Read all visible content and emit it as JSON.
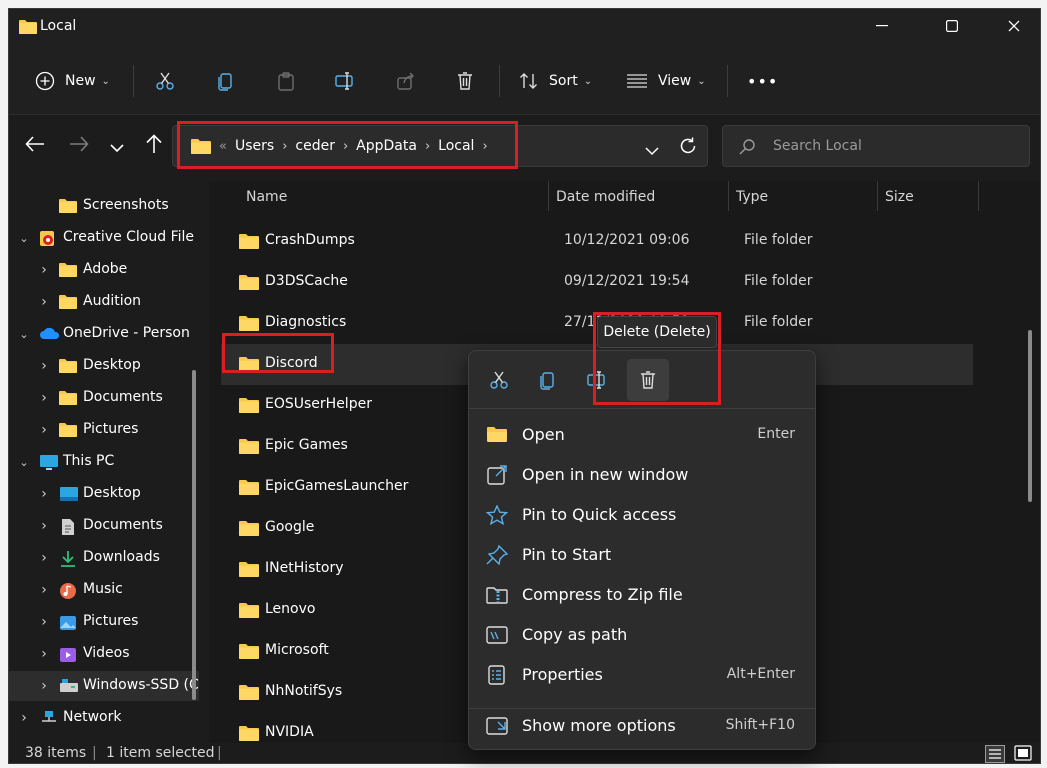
{
  "window": {
    "title": "Local"
  },
  "toolbar": {
    "new_label": "New",
    "sort_label": "Sort",
    "view_label": "View",
    "more_label": "•••"
  },
  "address": {
    "overflow": "«",
    "crumbs": [
      "Users",
      "ceder",
      "AppData",
      "Local"
    ]
  },
  "search": {
    "placeholder": "Search Local"
  },
  "sidebar": {
    "items": [
      {
        "label": "Screenshots",
        "icon": "folder-icon",
        "expandable": false
      },
      {
        "label": "Creative Cloud File",
        "icon": "creative-cloud-icon",
        "expandable": true,
        "expanded": true
      },
      {
        "label": "Adobe",
        "icon": "folder-icon",
        "expandable": true
      },
      {
        "label": "Audition",
        "icon": "folder-icon",
        "expandable": true
      },
      {
        "label": "OneDrive - Person",
        "icon": "onedrive-icon",
        "expandable": true,
        "expanded": true
      },
      {
        "label": "Desktop",
        "icon": "folder-icon",
        "expandable": true
      },
      {
        "label": "Documents",
        "icon": "folder-icon",
        "expandable": true
      },
      {
        "label": "Pictures",
        "icon": "folder-icon",
        "expandable": true
      },
      {
        "label": "This PC",
        "icon": "pc-icon",
        "expandable": true,
        "expanded": true
      },
      {
        "label": "Desktop",
        "icon": "desktop-icon",
        "expandable": true
      },
      {
        "label": "Documents",
        "icon": "documents-icon",
        "expandable": true
      },
      {
        "label": "Downloads",
        "icon": "downloads-icon",
        "expandable": true
      },
      {
        "label": "Music",
        "icon": "music-icon",
        "expandable": true
      },
      {
        "label": "Pictures",
        "icon": "pictures-icon",
        "expandable": true
      },
      {
        "label": "Videos",
        "icon": "videos-icon",
        "expandable": true
      },
      {
        "label": "Windows-SSD (C",
        "icon": "drive-icon",
        "expandable": true,
        "selected": true
      },
      {
        "label": "Network",
        "icon": "network-icon",
        "expandable": true
      }
    ]
  },
  "columns": {
    "name": "Name",
    "date": "Date modified",
    "type": "Type",
    "size": "Size"
  },
  "files": [
    {
      "name": "CrashDumps",
      "date": "10/12/2021 09:06",
      "type": "File folder"
    },
    {
      "name": "D3DSCache",
      "date": "09/12/2021 19:54",
      "type": "File folder"
    },
    {
      "name": "Diagnostics",
      "date": "27/11/2021 09:51",
      "type": "File folder"
    },
    {
      "name": "Discord",
      "date": "",
      "type": "",
      "selected": true
    },
    {
      "name": "EOSUserHelper",
      "date": "",
      "type": ""
    },
    {
      "name": "Epic Games",
      "date": "",
      "type": ""
    },
    {
      "name": "EpicGamesLauncher",
      "date": "",
      "type": ""
    },
    {
      "name": "Google",
      "date": "",
      "type": ""
    },
    {
      "name": "INetHistory",
      "date": "",
      "type": ""
    },
    {
      "name": "Lenovo",
      "date": "",
      "type": ""
    },
    {
      "name": "Microsoft",
      "date": "",
      "type": ""
    },
    {
      "name": "NhNotifSys",
      "date": "",
      "type": ""
    },
    {
      "name": "NVIDIA",
      "date": "",
      "type": ""
    }
  ],
  "status": {
    "items": "38 items",
    "selected": "1 item selected"
  },
  "context_menu": {
    "tooltip": "Delete (Delete)",
    "items": [
      {
        "label": "Open",
        "shortcut": "Enter",
        "icon": "folder-open-icon"
      },
      {
        "label": "Open in new window",
        "shortcut": "",
        "icon": "open-new-window-icon"
      },
      {
        "label": "Pin to Quick access",
        "shortcut": "",
        "icon": "star-icon"
      },
      {
        "label": "Pin to Start",
        "shortcut": "",
        "icon": "pin-icon"
      },
      {
        "label": "Compress to Zip file",
        "shortcut": "",
        "icon": "zip-icon"
      },
      {
        "label": "Copy as path",
        "shortcut": "",
        "icon": "copy-path-icon"
      },
      {
        "label": "Properties",
        "shortcut": "Alt+Enter",
        "icon": "properties-icon"
      }
    ],
    "more": {
      "label": "Show more options",
      "shortcut": "Shift+F10",
      "icon": "more-options-icon"
    }
  },
  "colors": {
    "accent": "#4cc2ff",
    "folder": "#f8c94a",
    "highlight": "#d81f26"
  }
}
